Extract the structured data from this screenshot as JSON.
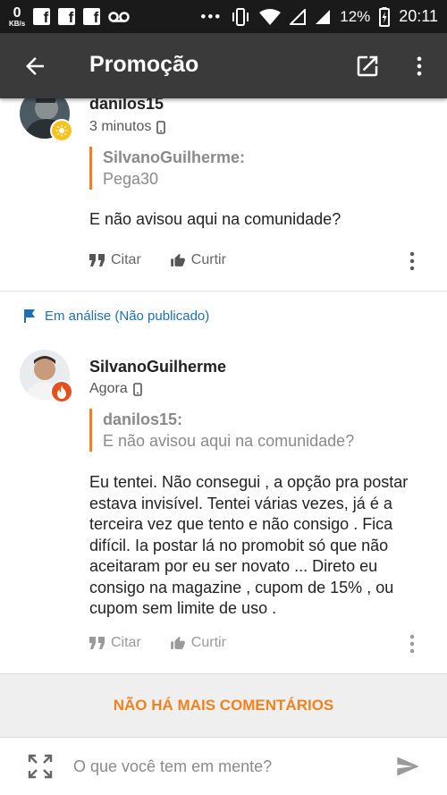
{
  "status_bar": {
    "speed_value": "0",
    "speed_unit": "KB/s",
    "battery": "12%",
    "time": "20:11",
    "icons": [
      "facebook-icon",
      "facebook-icon",
      "facebook-icon",
      "voicemail-icon",
      "more-icon",
      "vibrate-icon",
      "wifi-icon",
      "signal-icon",
      "signal-icon",
      "battery-icon"
    ]
  },
  "app_bar": {
    "title": "Promoção",
    "icons": [
      "back-arrow-icon",
      "open-external-icon",
      "more-vert-icon"
    ]
  },
  "comments": [
    {
      "author": "danilos15",
      "time": "3 minutos",
      "device_icon": "phone-icon",
      "quote": {
        "author": "SilvanoGuilherme:",
        "text": "Pega30"
      },
      "text": "E não avisou aqui na comunidade?",
      "actions": {
        "quote_label": "Citar",
        "like_label": "Curtir"
      }
    },
    {
      "status": "Em análise (Não publicado)",
      "author": "SilvanoGuilherme",
      "time": "Agora",
      "device_icon": "phone-icon",
      "quote": {
        "author": "danilos15:",
        "text": "E não avisou aqui na comunidade?"
      },
      "text": "Eu tentei. Não consegui , a opção pra postar estava invisível. Tentei várias vezes, já é a terceira vez que tento e não consigo . Fica difícil. Ia postar lá no promobit só que não aceitaram por eu ser novato ... Direto eu consigo na magazine , cupom de 15% , ou cupom sem limite de uso .",
      "actions": {
        "quote_label": "Citar",
        "like_label": "Curtir"
      }
    }
  ],
  "footer": {
    "no_more": "NÃO HÁ MAIS COMENTÁRIOS"
  },
  "composer": {
    "placeholder": "O que você tem em mente?",
    "value": ""
  },
  "colors": {
    "accent": "#f0821e",
    "link": "#1f6fb2",
    "app_bar": "#3a3a3a",
    "status_bar": "#1a1a1a"
  }
}
